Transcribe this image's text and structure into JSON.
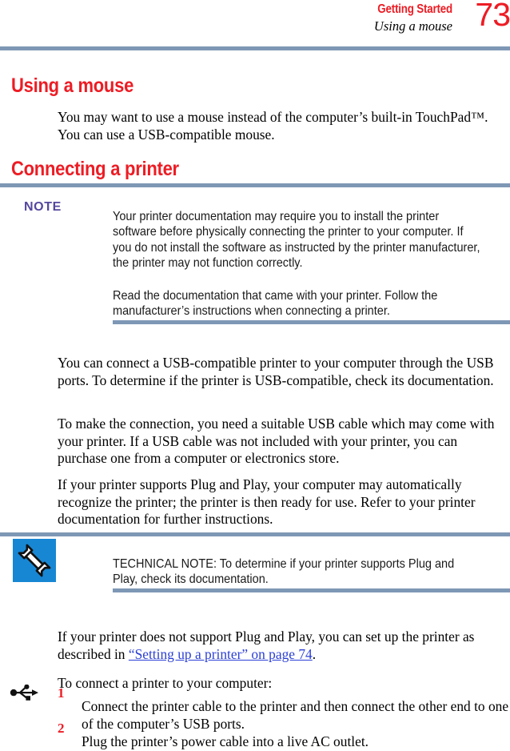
{
  "header": {
    "chapter": "Getting Started",
    "section": "Using a mouse",
    "page_number": "73"
  },
  "colors": {
    "heading_red": "#ED1C24",
    "rule_blue_gray": "#7E97B5",
    "note_label_purple": "#54479E",
    "link_blue": "#2B3FD6",
    "icon_blue": "#1787D4"
  },
  "sections": {
    "using_a_mouse": {
      "heading": "Using a mouse",
      "paragraph": "You may want to use a mouse instead of the computer’s built-in TouchPad™. You can use a USB-compatible mouse."
    },
    "connecting_a_printer": {
      "heading": "Connecting a printer"
    }
  },
  "note": {
    "label": "NOTE",
    "paragraph_1": "Your printer documentation may require you to install the printer software before physically connecting the printer to your computer. If you do not install the software as instructed by the printer manufacturer, the printer may not function correctly.",
    "paragraph_2": "Read the documentation that came with your printer. Follow the manufacturer’s instructions when connecting a printer."
  },
  "body": {
    "paragraph_1": "You can connect a USB-compatible printer to your computer through the USB ports. To determine if the printer is USB-compatible, check its documentation.",
    "paragraph_2": "To make the connection, you need a suitable USB cable which may come with your printer. If a USB cable was not included with your printer, you can purchase one from a computer or electronics store.",
    "paragraph_3": "If your printer supports Plug and Play, your computer may automatically recognize the printer; the printer is then ready for use. Refer to your printer documentation for further instructions."
  },
  "technical_note": {
    "icon": "wrench-icon",
    "paragraph": "TECHNICAL NOTE: To determine if your printer supports Plug and Play, check its documentation."
  },
  "plug_and_play": {
    "text_before_link": "If your printer does not support Plug and Play, you can set up the printer as described in ",
    "link_text": "“Setting up a printer” on page 74",
    "text_after_link": "."
  },
  "procedure": {
    "intro": "To connect a printer to your computer:",
    "marker_icon": "usb-icon",
    "steps": [
      {
        "number": "1",
        "text": "Connect the printer cable to the printer and then connect the other end to one of the computer’s USB ports."
      },
      {
        "number": "2",
        "text": "Plug the printer’s power cable into a live AC outlet."
      }
    ]
  }
}
